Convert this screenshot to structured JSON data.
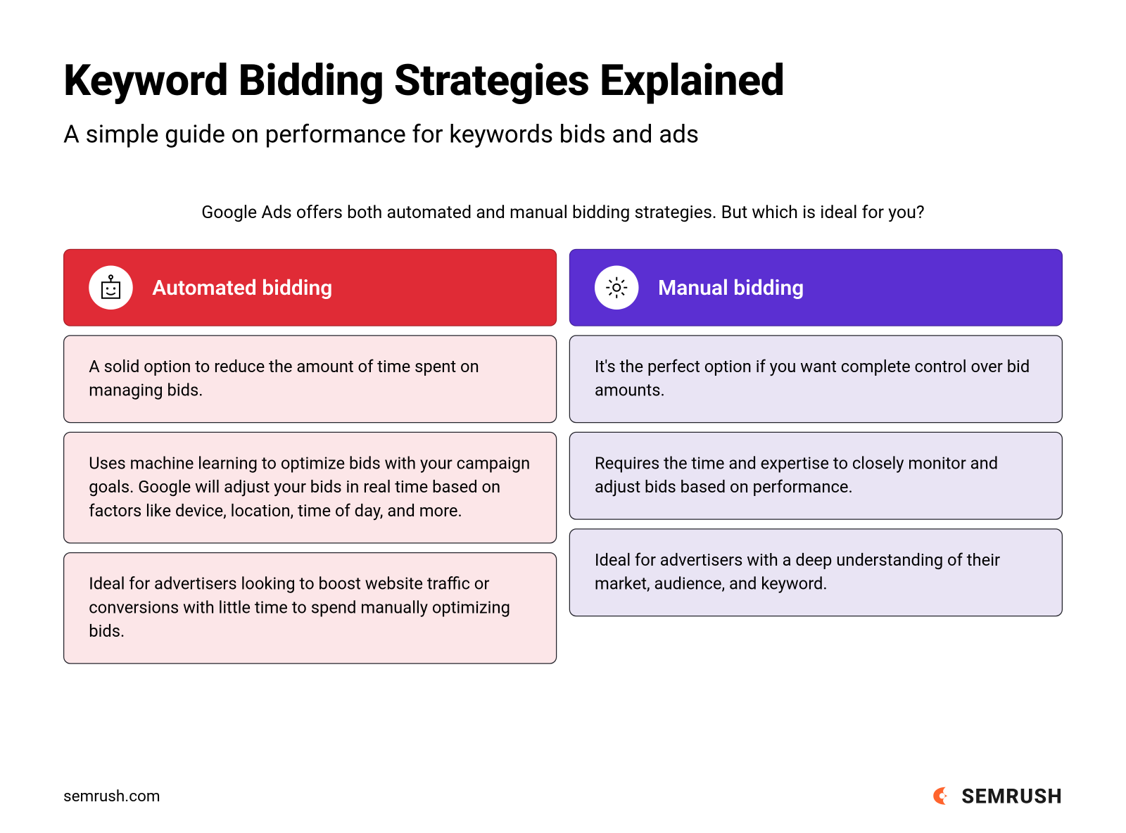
{
  "title": "Keyword Bidding Strategies Explained",
  "subtitle": "A simple guide on performance for keywords bids and ads",
  "intro": "Google Ads offers both automated and manual bidding strategies. But which is ideal for you?",
  "columns": {
    "automated": {
      "header": "Automated bidding",
      "cards": [
        "A solid option to reduce the amount of time spent on managing bids.",
        "Uses machine learning to optimize bids with your campaign goals. Google will adjust your bids in real time based on factors like device, location, time of day, and more.",
        "Ideal for advertisers looking to boost website traffic or conversions with little time to spend manually optimizing bids."
      ]
    },
    "manual": {
      "header": "Manual bidding",
      "cards": [
        "It's the perfect option if you want complete control over bid amounts.",
        "Requires the time and expertise to closely monitor and adjust bids based on performance.",
        "Ideal for advertisers with a deep understanding of their market, audience, and keyword."
      ]
    }
  },
  "footer": {
    "site": "semrush.com",
    "brand": "SEMRUSH"
  },
  "colors": {
    "red": "#e02b36",
    "purple": "#5b2fd2",
    "pink": "#fce6e8",
    "lavender": "#e9e4f4",
    "orange": "#ff642d"
  }
}
